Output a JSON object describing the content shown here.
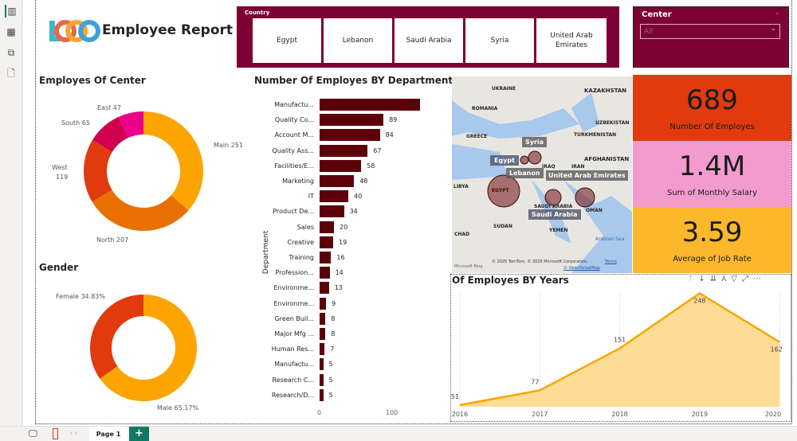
{
  "header": {
    "logo_text": "LOGO",
    "title": "Employee Report"
  },
  "sidebar": {
    "items": [
      {
        "icon": "report-view-icon"
      },
      {
        "icon": "table-view-icon"
      },
      {
        "icon": "model-view-icon"
      },
      {
        "icon": "dax-query-icon"
      }
    ]
  },
  "country_slicer": {
    "label": "Country",
    "options": [
      "Egypt",
      "Lebanon",
      "Saudi Arabia",
      "Syria",
      "United Arab Emirates"
    ]
  },
  "center_slicer": {
    "label": "Center",
    "value": "All"
  },
  "center_donut": {
    "title": "Employes Of Center",
    "chart_data": {
      "type": "pie",
      "categories": [
        "Main",
        "North",
        "West",
        "South",
        "East"
      ],
      "values": [
        251,
        207,
        119,
        65,
        47
      ],
      "labels": [
        "Main 251",
        "North 207",
        "West",
        "119",
        "South 65",
        "East 47"
      ],
      "colors": [
        "#fca500",
        "#e86f00",
        "#e03a0e",
        "#d1004f",
        "#ea008b"
      ]
    }
  },
  "gender_donut": {
    "title": "Gender",
    "chart_data": {
      "type": "pie",
      "categories": [
        "Male",
        "Female"
      ],
      "values": [
        65.17,
        34.83
      ],
      "labels": [
        "Male 65.17%",
        "Female 34.83%"
      ],
      "colors": [
        "#fca500",
        "#e03a0e"
      ]
    }
  },
  "dept_chart": {
    "title": "Number Of Employes BY Department",
    "ylabel": "Department",
    "chart_data": {
      "type": "bar",
      "orientation": "horizontal",
      "categories": [
        "Manufactu...",
        "Quality Co...",
        "Account M...",
        "Quality Ass...",
        "Facilities/E...",
        "Marketing",
        "IT",
        "Product De...",
        "Sales",
        "Creative",
        "Training",
        "Profession...",
        "Environme...",
        "Environme...",
        "Green Buil...",
        "Major Mfg ...",
        "Human Res...",
        "Manufactu...",
        "Research C...",
        "Research/D..."
      ],
      "values": [
        140,
        89,
        84,
        67,
        58,
        48,
        40,
        34,
        20,
        19,
        16,
        14,
        13,
        9,
        8,
        8,
        7,
        5,
        5,
        5
      ],
      "xticks": [
        "0",
        "100"
      ],
      "color": "#5c0009"
    }
  },
  "map": {
    "labels": [
      "Syria",
      "Egypt",
      "Lebanon",
      "United Arab Emirates",
      "Saudi Arabia"
    ],
    "base_labels": [
      "UKRAINE",
      "ROMANIA",
      "KAZAKHSTAN",
      "UZBEKISTAN",
      "GREECE",
      "TURKMENISTAN",
      "IRAQ",
      "IRAN",
      "AFGHANISTAN",
      "LIBYA",
      "EGYPT",
      "SAUDI ARABIA",
      "OMAN",
      "SUDAN",
      "YEMEN",
      "CHAD",
      "Arabian Sea"
    ],
    "attribution": "© 2025 TomTom, © 2025 Microsoft Corporation,",
    "terms": "Terms",
    "osm": "© OpenStreetMap",
    "bing": "Microsoft Bing"
  },
  "kpis": [
    {
      "value": "689",
      "label": "Number Of Employes",
      "color": "#e03a0e"
    },
    {
      "value": "1.4M",
      "label": "Sum of Monthly Salary",
      "color": "#f39bce"
    },
    {
      "value": "3.59",
      "label": "Average of Job Rate",
      "color": "#fcb72a"
    }
  ],
  "years_chart": {
    "title": "Of Employes BY Years",
    "chart_data": {
      "type": "area",
      "x": [
        "2016",
        "2017",
        "2018",
        "2019",
        "2020"
      ],
      "values": [
        51,
        77,
        151,
        248,
        162
      ],
      "color": "#fca500"
    }
  },
  "footer": {
    "page_tab": "Page 1",
    "add": "+"
  }
}
